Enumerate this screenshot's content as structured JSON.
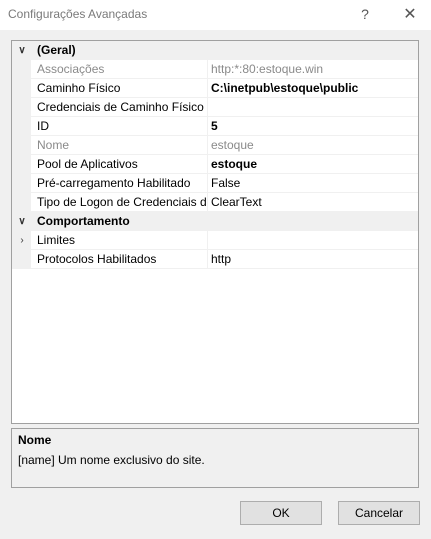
{
  "window": {
    "title": "Configurações Avançadas",
    "help": "?",
    "close": "✕"
  },
  "grid": {
    "categories": [
      {
        "label": "(Geral)",
        "rows": [
          {
            "name": "Associações",
            "value": "http:*:80:estoque.win",
            "grayed": true
          },
          {
            "name": "Caminho Físico",
            "value": "C:\\inetpub\\estoque\\public",
            "bold": true
          },
          {
            "name": "Credenciais de Caminho Físico",
            "value": ""
          },
          {
            "name": "ID",
            "value": "5",
            "bold": true
          },
          {
            "name": "Nome",
            "value": "estoque",
            "grayed": true
          },
          {
            "name": "Pool de Aplicativos",
            "value": "estoque",
            "bold": true
          },
          {
            "name": "Pré-carregamento Habilitado",
            "value": "False"
          },
          {
            "name": "Tipo de Logon de Credenciais de Caminho Físico",
            "value": "ClearText"
          }
        ]
      },
      {
        "label": "Comportamento",
        "rows": [
          {
            "name": "Limites",
            "value": "",
            "expandable": true
          },
          {
            "name": "Protocolos Habilitados",
            "value": "http"
          }
        ]
      }
    ]
  },
  "description": {
    "title": "Nome",
    "text": "[name] Um nome exclusivo do site."
  },
  "buttons": {
    "ok": "OK",
    "cancel": "Cancelar"
  }
}
